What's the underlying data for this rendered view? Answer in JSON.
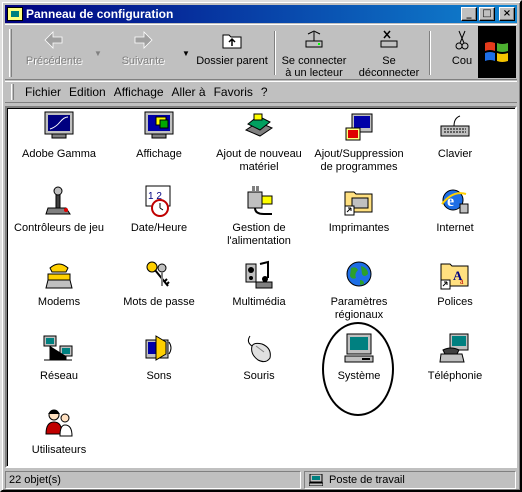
{
  "window": {
    "title": "Panneau de configuration",
    "minimize": "_",
    "maximize": "□",
    "close": "×"
  },
  "toolbar": {
    "back": "Précédente",
    "forward": "Suivante",
    "up": "Dossier parent",
    "map_drive_line1": "Se connecter",
    "map_drive_line2": "à un lecteur",
    "disconnect_line1": "Se",
    "disconnect_line2": "déconnecter",
    "cut": "Cou"
  },
  "menu": {
    "file": "Fichier",
    "edit": "Edition",
    "view": "Affichage",
    "go": "Aller à",
    "favorites": "Favoris",
    "help": "?"
  },
  "items": [
    {
      "label": "Adobe Gamma",
      "icon": "monitor-gamma-icon"
    },
    {
      "label": "Affichage",
      "icon": "display-icon"
    },
    {
      "label": "Ajout de nouveau matériel",
      "icon": "add-hardware-icon"
    },
    {
      "label": "Ajout/Suppression de programmes",
      "icon": "add-remove-programs-icon"
    },
    {
      "label": "Clavier",
      "icon": "keyboard-icon"
    },
    {
      "label": "Contrôleurs de jeu",
      "icon": "joystick-icon"
    },
    {
      "label": "Date/Heure",
      "icon": "calendar-clock-icon"
    },
    {
      "label": "Gestion de l'alimentation",
      "icon": "power-plug-icon"
    },
    {
      "label": "Imprimantes",
      "icon": "printer-folder-icon"
    },
    {
      "label": "Internet",
      "icon": "internet-globe-icon"
    },
    {
      "label": "Modems",
      "icon": "modem-telephone-icon"
    },
    {
      "label": "Mots de passe",
      "icon": "keys-icon"
    },
    {
      "label": "Multimédia",
      "icon": "multimedia-icon"
    },
    {
      "label": "Paramètres régionaux",
      "icon": "globe-icon"
    },
    {
      "label": "Polices",
      "icon": "fonts-folder-icon"
    },
    {
      "label": "Réseau",
      "icon": "network-icon"
    },
    {
      "label": "Sons",
      "icon": "speaker-icon"
    },
    {
      "label": "Souris",
      "icon": "mouse-icon"
    },
    {
      "label": "Système",
      "icon": "computer-icon"
    },
    {
      "label": "Téléphonie",
      "icon": "telephony-icon"
    },
    {
      "label": "Utilisateurs",
      "icon": "users-icon"
    }
  ],
  "status": {
    "count": "22 objet(s)",
    "location": "Poste de travail"
  }
}
